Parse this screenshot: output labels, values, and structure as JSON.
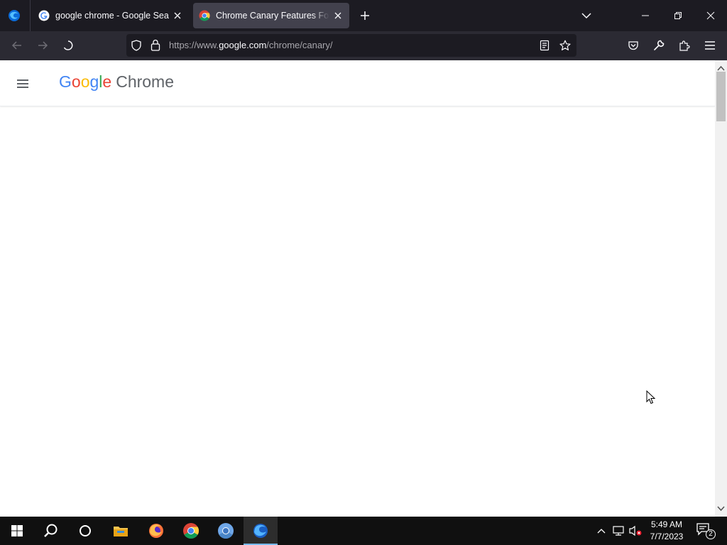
{
  "browser": {
    "tabs": [
      {
        "title": "google chrome - Google Search",
        "favicon": "google-g-icon",
        "active": false
      },
      {
        "title": "Chrome Canary Features For Developers",
        "favicon": "chrome-icon",
        "active": true
      }
    ],
    "url": {
      "prefix": "https://www.",
      "domain": "google.com",
      "path": "/chrome/canary/"
    }
  },
  "site": {
    "brand_letters": [
      "G",
      "o",
      "o",
      "g",
      "l",
      "e"
    ],
    "product": "Chrome"
  },
  "taskbar": {
    "time": "5:49 AM",
    "date": "7/7/2023",
    "notification_count": "2"
  },
  "colors": {
    "tabstrip_bg": "#1c1b22",
    "toolbar_bg": "#2b2a33",
    "active_tab_bg": "#42414d",
    "google_blue": "#4285f4",
    "google_red": "#ea4335",
    "google_yellow": "#fbbc05",
    "google_green": "#34a853"
  }
}
